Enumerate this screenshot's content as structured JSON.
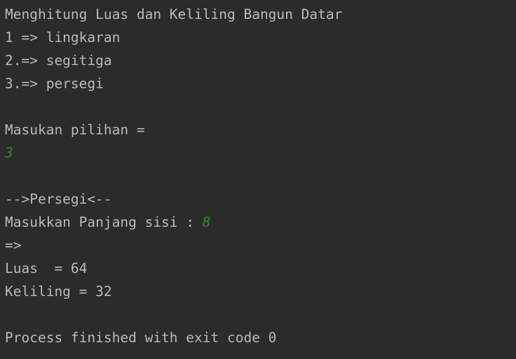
{
  "console": {
    "title_line": "Menghitung Luas dan Keliling Bangun Datar",
    "option_1": "1 => lingkaran",
    "option_2": "2.=> segitiga",
    "option_3": "3.=> persegi",
    "prompt_choice": "Masukan pilihan =",
    "user_choice": "3",
    "section_header": "-->Persegi<--",
    "prompt_side": "Masukkan Panjang sisi : ",
    "user_side": "8",
    "arrow_line": "=>",
    "area_result": "Luas  = 64",
    "perimeter_result": "Keliling = 32",
    "exit_message": "Process finished with exit code 0"
  },
  "colors": {
    "background": "#2b2b2b",
    "text": "#bbbbbb",
    "user_input": "#2d8a2d"
  }
}
